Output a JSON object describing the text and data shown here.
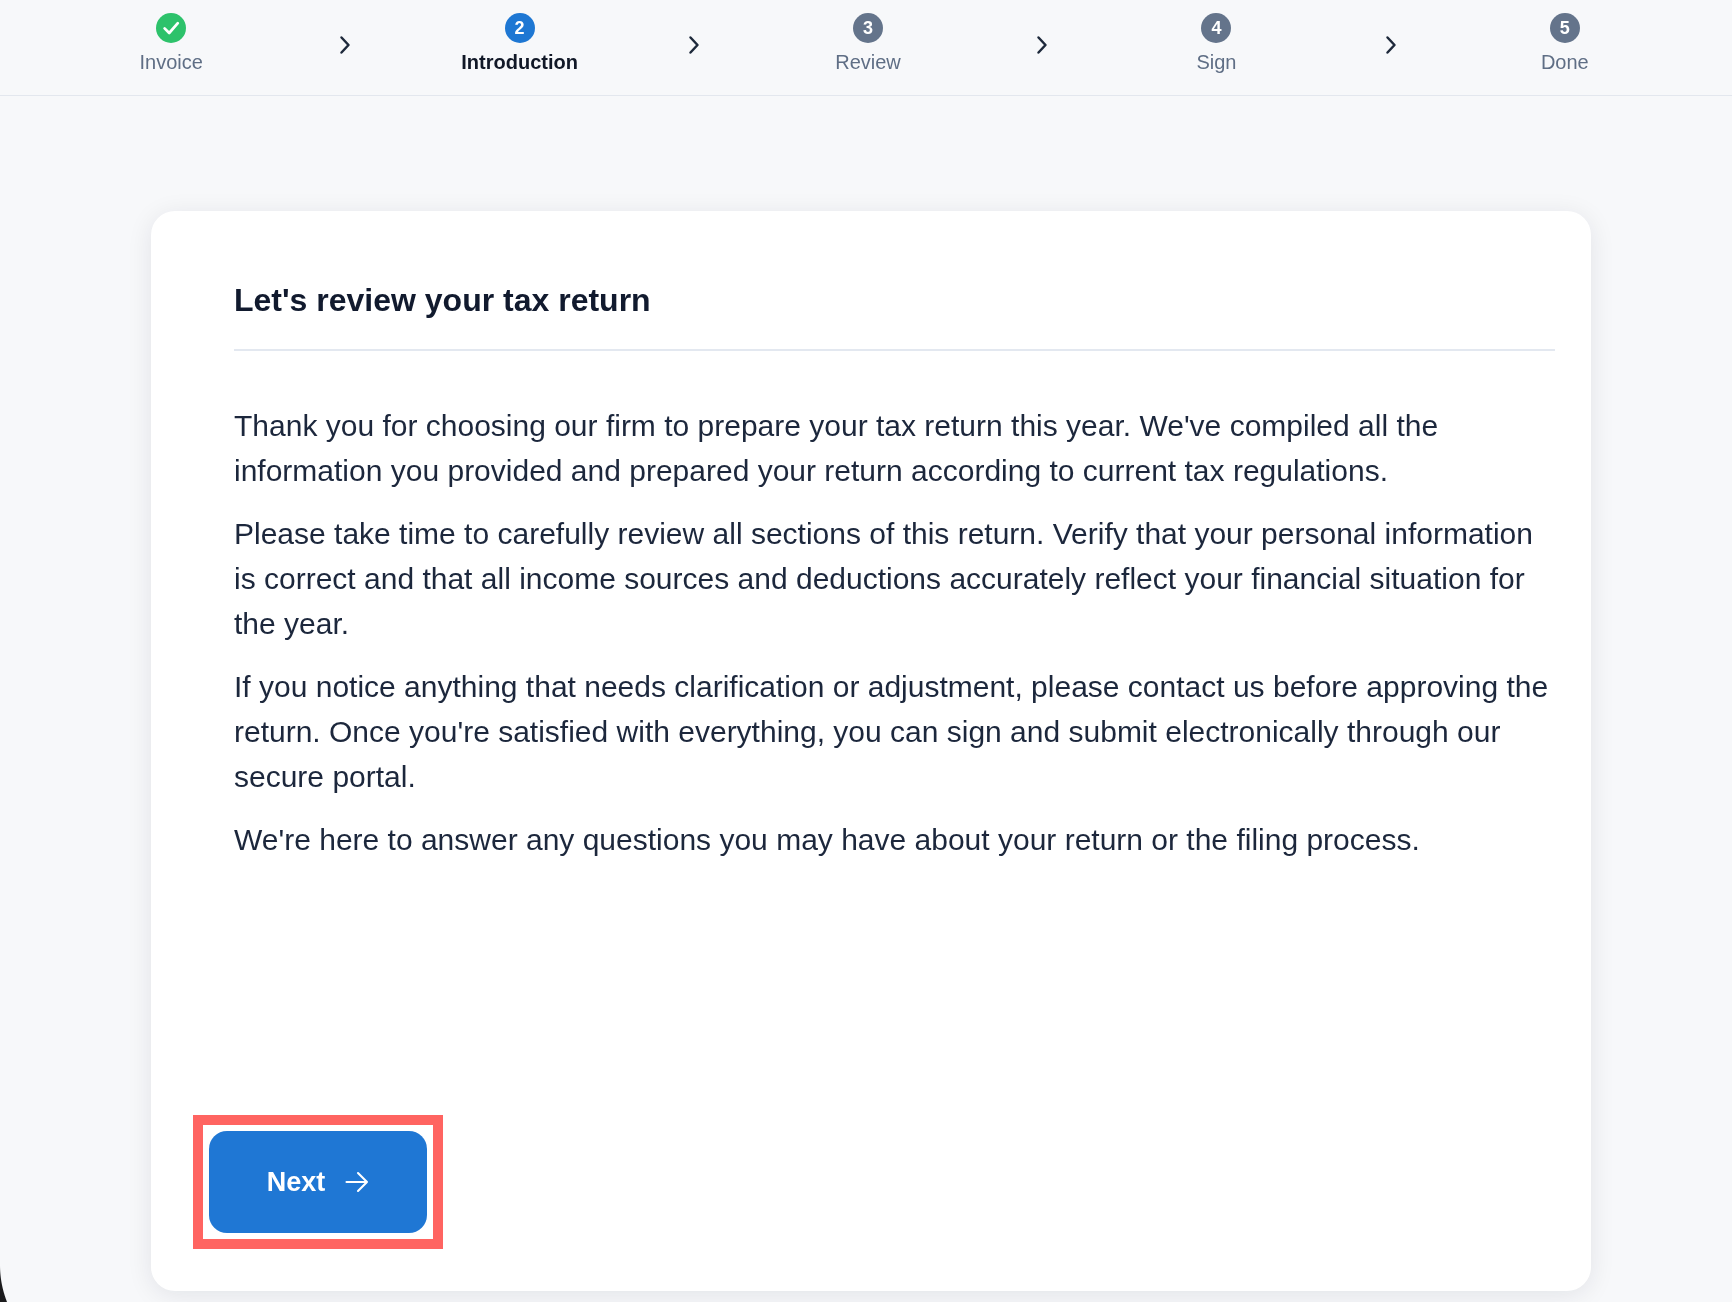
{
  "steps": [
    {
      "label": "Invoice",
      "completed": true,
      "selected": false
    },
    {
      "label": "Introduction",
      "number": "2",
      "completed": false,
      "selected": true
    },
    {
      "label": "Review",
      "number": "3",
      "completed": false,
      "selected": false
    },
    {
      "label": "Sign",
      "number": "4",
      "completed": false,
      "selected": false
    },
    {
      "label": "Done",
      "number": "5",
      "completed": false,
      "selected": false
    }
  ],
  "card": {
    "title": "Let's review your tax return",
    "paragraphs": [
      "Thank you for choosing our firm to prepare your tax return this year. We've compiled all the information you provided and prepared your return according to current tax regulations.",
      "Please take time to carefully review all sections of this return. Verify that your personal information is correct and that all income sources and deductions accurately reflect your financial situation for the year.",
      "If you notice anything that needs clarification or adjustment, please contact us before approving the return. Once you're satisfied with everything, you can sign and submit electronically through our secure portal.",
      "We're here to answer any questions you may have about your return or the filing process."
    ],
    "next_button": {
      "label": "Next",
      "highlighted": true
    }
  }
}
